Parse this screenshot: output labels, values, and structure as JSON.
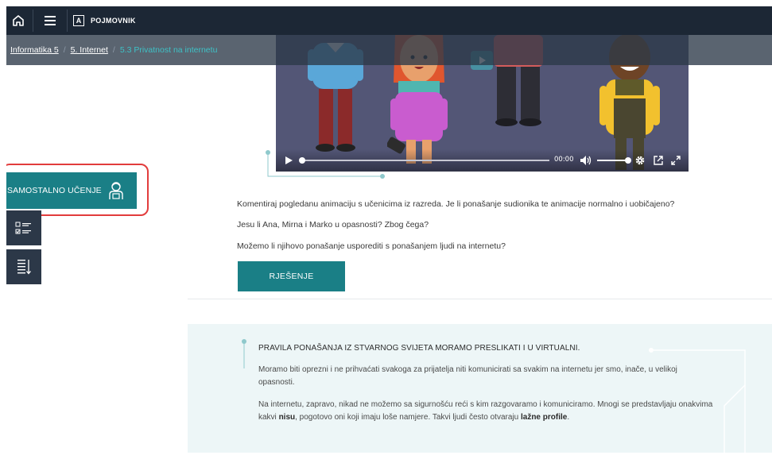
{
  "topbar": {
    "home_icon": "home-icon",
    "menu_icon": "hamburger-icon",
    "glossary_icon_letter": "A",
    "glossary_label": "POJMOVNIK"
  },
  "breadcrumb": {
    "items": [
      "Informatika 5",
      "5. Internet"
    ],
    "current": "5.3 Privatnost na internetu"
  },
  "video": {
    "time": "00:00",
    "progress": 0,
    "volume": 1.0
  },
  "sidebar": {
    "self_study_label": "SAMOSTALNO UČENJE",
    "self_study_icon": "student-icon",
    "checklist_icon": "checklist-icon",
    "sort_icon": "list-sort-icon"
  },
  "questions": [
    "Komentiraj pogledanu animaciju s učenicima iz razreda. Je li ponašanje sudionika te animacije normalno i uobičajeno?",
    "Jesu li Ana, Mirna i Marko u opasnosti? Zbog čega?",
    "Možemo li njihovo ponašanje usporediti s ponašanjem ljudi na internetu?"
  ],
  "solution_button": "RJEŠENJE",
  "infobox": {
    "title": "PRAVILA PONAŠANJA IZ STVARNOG SVIJETA MORAMO PRESLIKATI I U VIRTUALNI.",
    "p1": "Moramo biti oprezni i ne prihvaćati svakoga za prijatelja niti komunicirati sa svakim na internetu jer smo, inače, u velikoj opasnosti.",
    "p2_a": "Na internetu, zapravo, nikad ne možemo sa sigurnošću reći s kim razgovaramo i komuniciramo. Mnogi se predstavljaju onakvima kakvi ",
    "p2_bold1": "nisu",
    "p2_b": ", pogotovo oni koji imaju loše namjere. Takvi ljudi često otvaraju ",
    "p2_bold2": "lažne profile",
    "p2_c": "."
  },
  "colors": {
    "topbar": "#1c2735",
    "teal": "#1a7f86",
    "accent_cyan": "#3ec1c6",
    "highlight_red": "#e23c3c",
    "video_bg": "#535676",
    "info_bg": "#edf6f7"
  }
}
